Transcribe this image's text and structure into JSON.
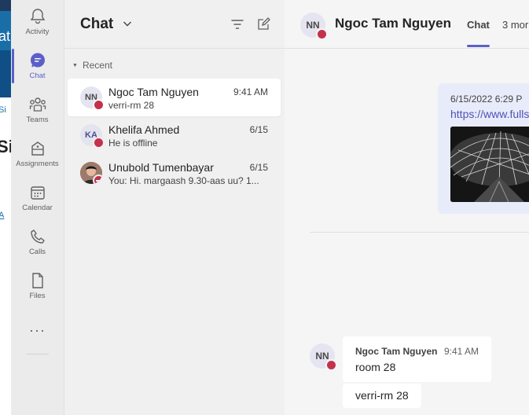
{
  "background_app": {
    "fragments": [
      "at",
      "Si",
      "Si",
      "A"
    ]
  },
  "rail": {
    "items": [
      {
        "label": "Activity",
        "icon": "bell-icon"
      },
      {
        "label": "Chat",
        "icon": "chat-icon"
      },
      {
        "label": "Teams",
        "icon": "teams-icon"
      },
      {
        "label": "Assignments",
        "icon": "assignments-icon"
      },
      {
        "label": "Calendar",
        "icon": "calendar-icon"
      },
      {
        "label": "Calls",
        "icon": "phone-icon"
      },
      {
        "label": "Files",
        "icon": "file-icon"
      }
    ],
    "more": "···"
  },
  "chat_list": {
    "title": "Chat",
    "section": "Recent",
    "rows": [
      {
        "initials": "NN",
        "name": "Ngoc Tam Nguyen",
        "time": "9:41 AM",
        "preview": "verri-rm 28",
        "status": "busy"
      },
      {
        "initials": "KA",
        "name": "Khelifa Ahmed",
        "time": "6/15",
        "preview": "He is offline",
        "status": "busy"
      },
      {
        "initials": "",
        "name": "Unubold Tumenbayar",
        "time": "6/15",
        "preview": "You: Hi. margaash 9.30-aas uu? 1...",
        "status": "do-not-disturb"
      }
    ]
  },
  "conversation": {
    "initials": "NN",
    "name": "Ngoc Tam Nguyen",
    "tabs": [
      "Chat",
      "3 mor"
    ],
    "outgoing": {
      "timestamp": "6/15/2022 6:29 P",
      "link": "https://www.fulls"
    },
    "incoming": {
      "sender": "Ngoc Tam Nguyen",
      "time": "9:41 AM",
      "messages": [
        "room 28",
        "verri-rm 28"
      ]
    }
  },
  "colors": {
    "accent": "#5b5fc7",
    "busy": "#c4314b",
    "link": "#4f52b2",
    "outgoing_bubble": "#e8ebfa"
  }
}
